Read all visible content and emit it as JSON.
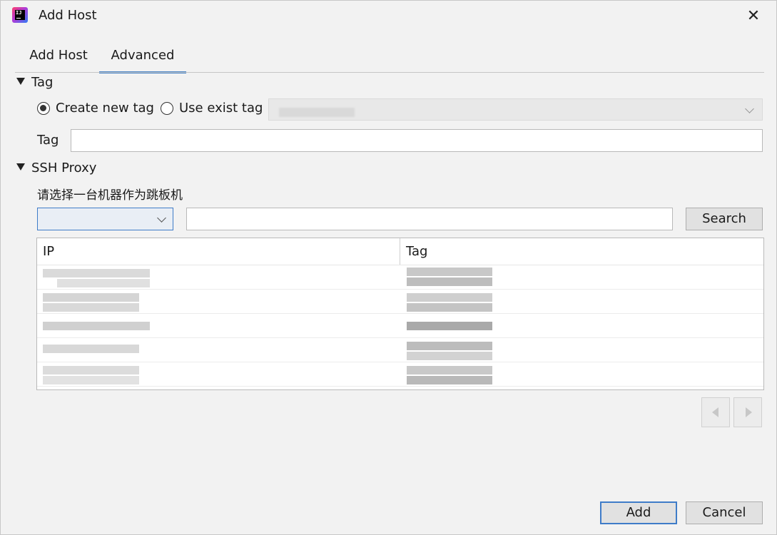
{
  "window": {
    "title": "Add Host",
    "app_icon": "intellij-logo-icon",
    "app_icon_text": "IJ",
    "close_glyph": "✕"
  },
  "tabs": [
    {
      "label": "Add Host",
      "active": false
    },
    {
      "label": "Advanced",
      "active": true
    }
  ],
  "tag_section": {
    "heading": "Tag",
    "expanded": true,
    "radio_create": {
      "label": "Create new tag",
      "checked": true
    },
    "radio_use": {
      "label": "Use exist tag",
      "checked": false
    },
    "exist_tag_select": {
      "enabled": false,
      "value": "(redacted)"
    },
    "tag_field": {
      "label": "Tag",
      "value": ""
    }
  },
  "ssh_section": {
    "heading": "SSH Proxy",
    "expanded": true,
    "instruction": "请选择一台机器作为跳板机",
    "filter_select": {
      "value": ""
    },
    "search_input": {
      "value": ""
    },
    "search_button": "Search",
    "table": {
      "columns": [
        "IP",
        "Tag"
      ],
      "rows": [
        {
          "ip": "(redacted)",
          "tag": "(redacted)"
        },
        {
          "ip": "(redacted)",
          "tag": "(redacted)"
        },
        {
          "ip": "(redacted)",
          "tag": "(redacted)"
        },
        {
          "ip": "(redacted)",
          "tag": "(redacted)"
        },
        {
          "ip": "(redacted)",
          "tag": "(redacted)"
        }
      ]
    },
    "pager": {
      "prev_enabled": false,
      "next_enabled": false
    }
  },
  "footer": {
    "add_button": "Add",
    "cancel_button": "Cancel"
  },
  "colors": {
    "accent": "#3f7cc8",
    "tab_underline": "#4a84c6",
    "background": "#f2f2f2"
  }
}
